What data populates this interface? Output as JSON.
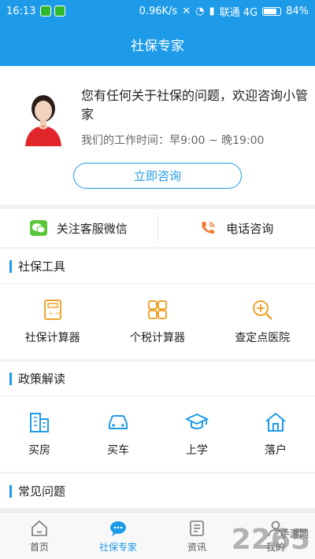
{
  "status_bar": {
    "time": "16:13",
    "speed": "0.96K/s",
    "carrier": "联通 4G",
    "battery": "84%"
  },
  "header": {
    "title": "社保专家"
  },
  "consult": {
    "message": "您有任何关于社保的问题，欢迎咨询小管家",
    "hours": "我们的工作时间：早9:00 ~ 晚19:00",
    "button": "立即咨询"
  },
  "contact": {
    "wechat": "关注客服微信",
    "phone": "电话咨询"
  },
  "sections": {
    "tools": {
      "title": "社保工具",
      "items": [
        "社保计算器",
        "个税计算器",
        "查定点医院"
      ]
    },
    "policy": {
      "title": "政策解读",
      "items": [
        "买房",
        "买车",
        "上学",
        "落户"
      ]
    },
    "faq": {
      "title": "常见问题"
    }
  },
  "bottom_nav": {
    "tabs": [
      "首页",
      "社保专家",
      "资讯",
      "我的"
    ],
    "active": 1
  },
  "watermark": {
    "text": "2265",
    "sub": "手游网"
  },
  "colors": {
    "primary": "#1e9be8",
    "icon_orange": "#f0a431",
    "wechat_green": "#5ac53a",
    "phone_orange": "#f07a30"
  }
}
